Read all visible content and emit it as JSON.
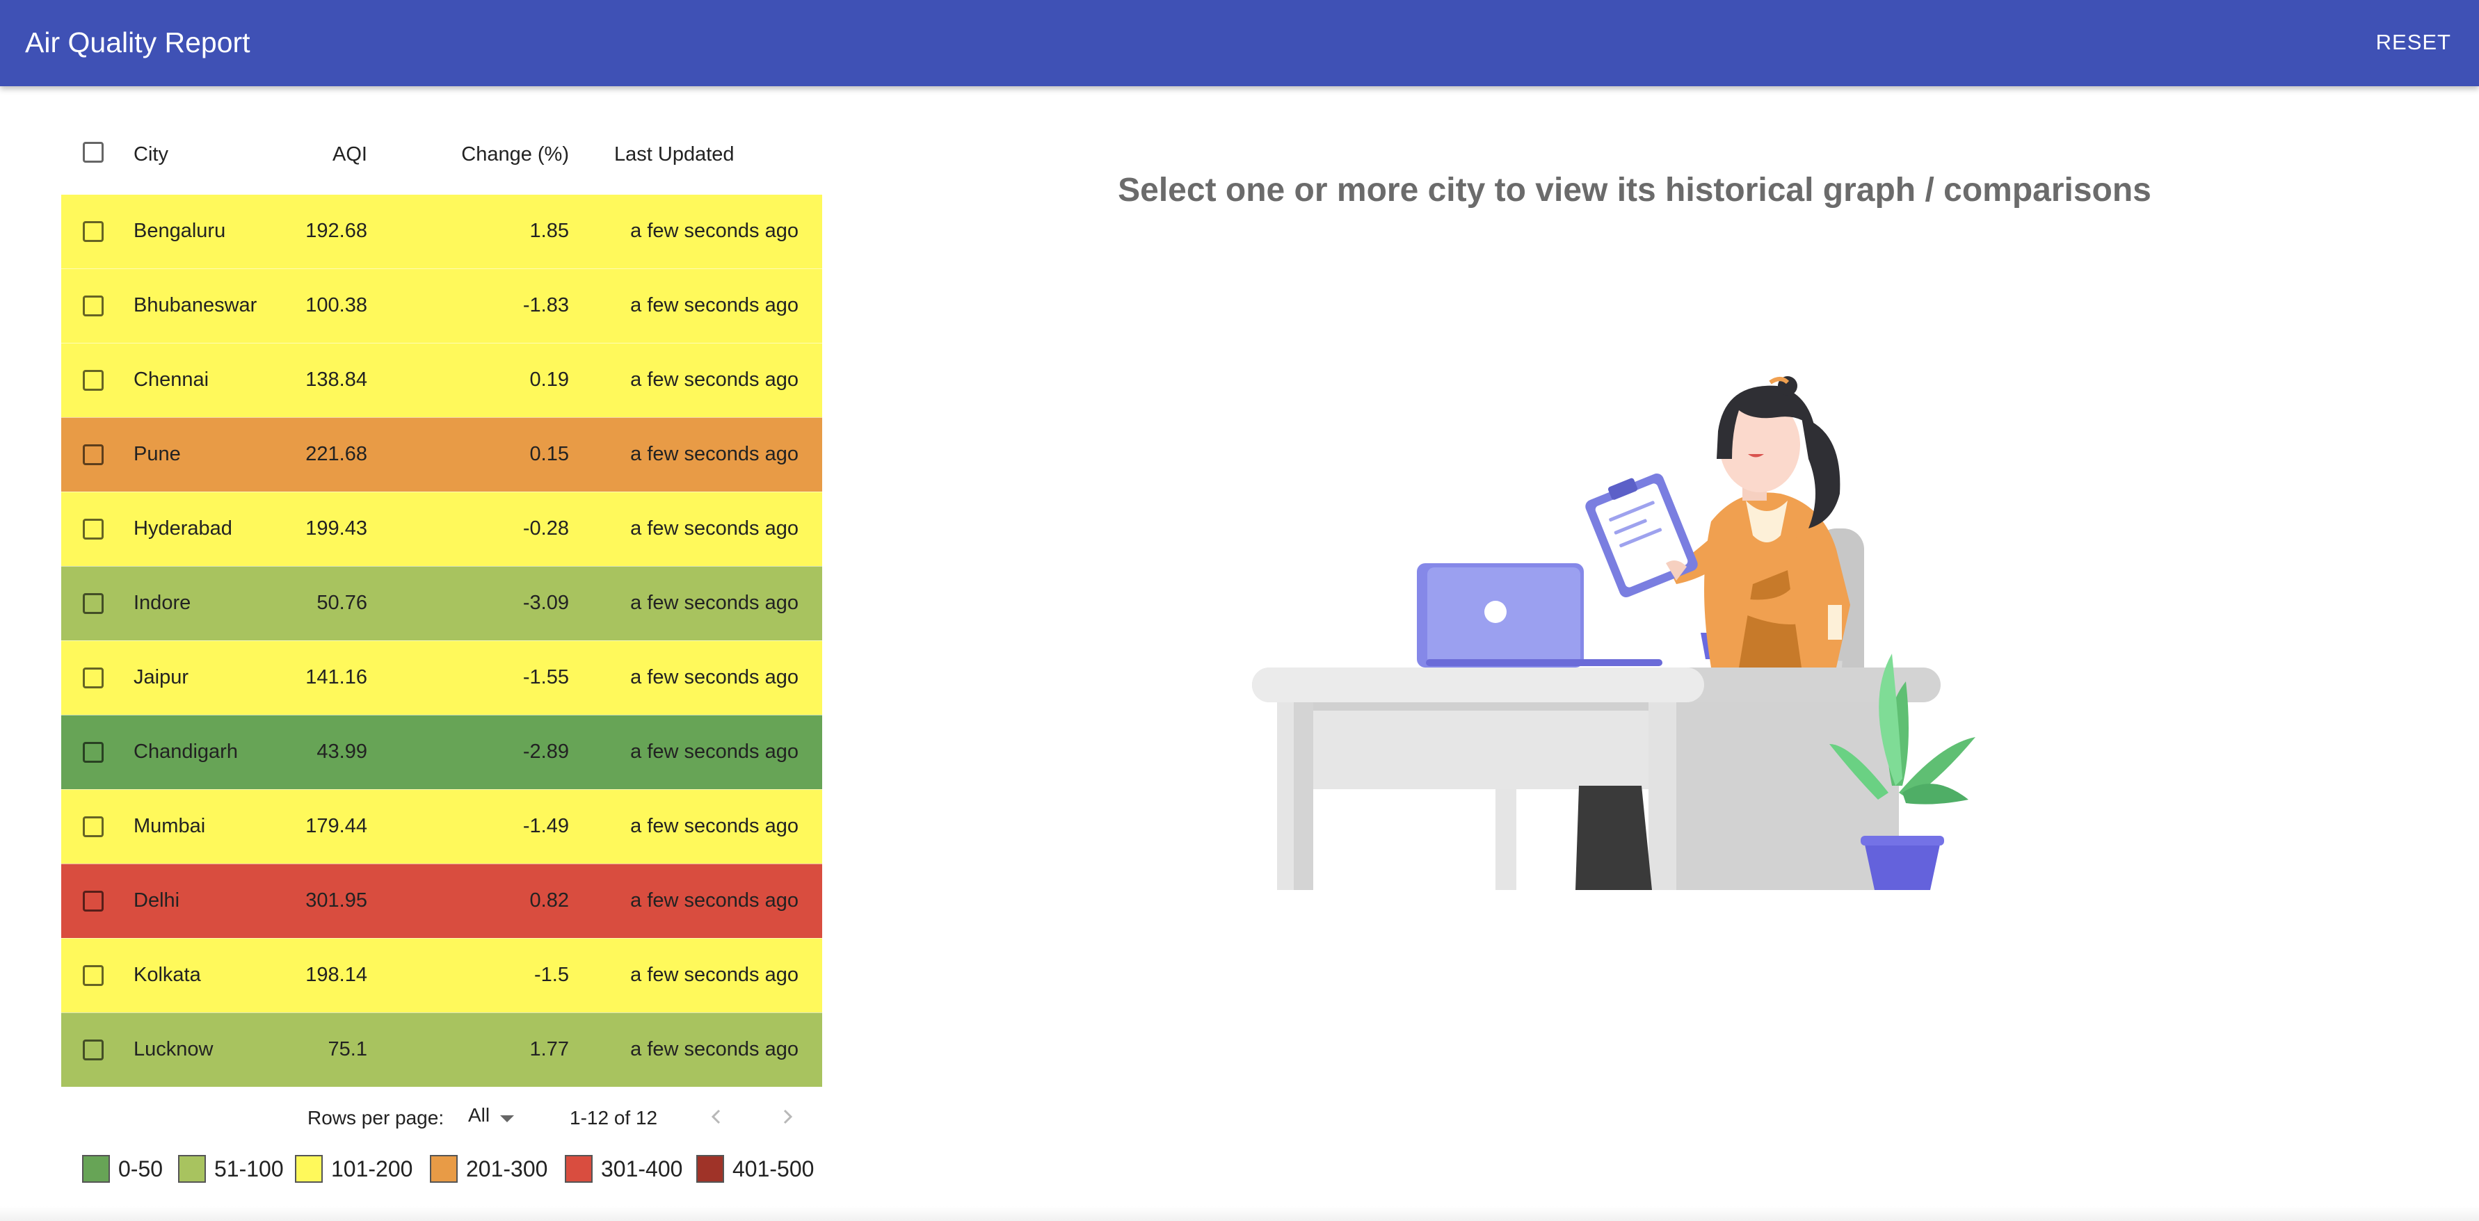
{
  "app": {
    "title": "Air Quality Report",
    "reset_label": "RESET"
  },
  "table": {
    "headers": {
      "city": "City",
      "aqi": "AQI",
      "change": "Change (%)",
      "updated": "Last Updated"
    },
    "rows": [
      {
        "city": "Bengaluru",
        "aqi": "192.68",
        "change": "1.85",
        "updated": "a few seconds ago",
        "color": "#fff95b"
      },
      {
        "city": "Bhubaneswar",
        "aqi": "100.38",
        "change": "-1.83",
        "updated": "a few seconds ago",
        "color": "#fff95b"
      },
      {
        "city": "Chennai",
        "aqi": "138.84",
        "change": "0.19",
        "updated": "a few seconds ago",
        "color": "#fff95b"
      },
      {
        "city": "Pune",
        "aqi": "221.68",
        "change": "0.15",
        "updated": "a few seconds ago",
        "color": "#e89b46"
      },
      {
        "city": "Hyderabad",
        "aqi": "199.43",
        "change": "-0.28",
        "updated": "a few seconds ago",
        "color": "#fff95b"
      },
      {
        "city": "Indore",
        "aqi": "50.76",
        "change": "-3.09",
        "updated": "a few seconds ago",
        "color": "#a8c35f"
      },
      {
        "city": "Jaipur",
        "aqi": "141.16",
        "change": "-1.55",
        "updated": "a few seconds ago",
        "color": "#fff95b"
      },
      {
        "city": "Chandigarh",
        "aqi": "43.99",
        "change": "-2.89",
        "updated": "a few seconds ago",
        "color": "#67a456"
      },
      {
        "city": "Mumbai",
        "aqi": "179.44",
        "change": "-1.49",
        "updated": "a few seconds ago",
        "color": "#fff95b"
      },
      {
        "city": "Delhi",
        "aqi": "301.95",
        "change": "0.82",
        "updated": "a few seconds ago",
        "color": "#d94d3f"
      },
      {
        "city": "Kolkata",
        "aqi": "198.14",
        "change": "-1.5",
        "updated": "a few seconds ago",
        "color": "#fff95b"
      },
      {
        "city": "Lucknow",
        "aqi": "75.1",
        "change": "1.77",
        "updated": "a few seconds ago",
        "color": "#a8c35f"
      }
    ]
  },
  "pagination": {
    "rows_per_page_label": "Rows per page:",
    "rows_per_page_value": "All",
    "range_label": "1-12 of 12"
  },
  "legend": [
    {
      "label": "0-50",
      "color": "#67a456"
    },
    {
      "label": "51-100",
      "color": "#a8c35f"
    },
    {
      "label": "101-200",
      "color": "#fff95b"
    },
    {
      "label": "201-300",
      "color": "#e89b46"
    },
    {
      "label": "301-400",
      "color": "#d94d3f"
    },
    {
      "label": "401-500",
      "color": "#9f3328"
    }
  ],
  "main": {
    "prompt": "Select one or more city to view its historical graph / comparisons"
  },
  "icons": {
    "prev": "chevron-left-icon",
    "next": "chevron-right-icon",
    "dropdown": "arrow-drop-down-icon",
    "illustration": "woman-at-desk-illustration"
  }
}
